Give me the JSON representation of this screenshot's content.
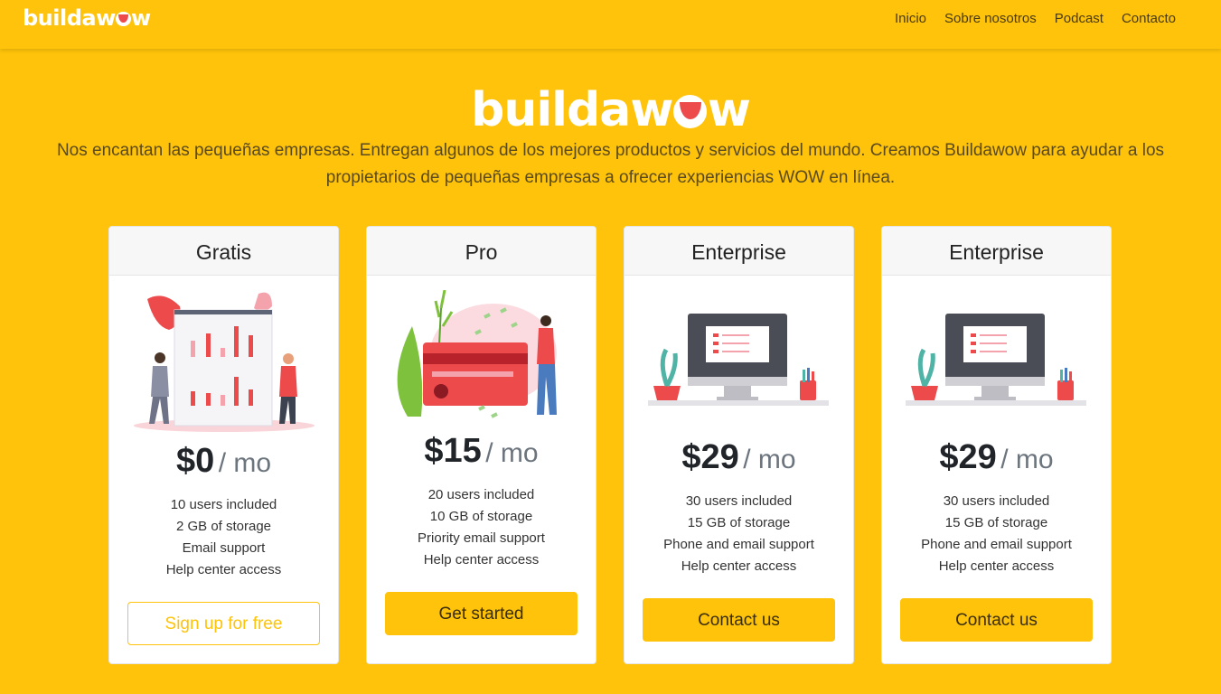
{
  "nav": {
    "brand": "buildawow",
    "links": [
      "Inicio",
      "Sobre nosotros",
      "Podcast",
      "Contacto"
    ]
  },
  "hero": {
    "logo": "buildawow",
    "tagline": "Nos encantan las pequeñas empresas. Entregan algunos de los mejores productos y servicios del mundo. Creamos Buildawow para ayudar a los propietarios de pequeñas empresas a ofrecer experiencias WOW en línea."
  },
  "plans": [
    {
      "name": "Gratis",
      "illustration": "team-chart-illustration",
      "price": "$0",
      "period": "/ mo",
      "features": [
        "10 users included",
        "2 GB of storage",
        "Email support",
        "Help center access"
      ],
      "button": "Sign up for free",
      "button_style": "outline"
    },
    {
      "name": "Pro",
      "illustration": "credit-card-illustration",
      "price": "$15",
      "period": "/ mo",
      "features": [
        "20 users included",
        "10 GB of storage",
        "Priority email support",
        "Help center access"
      ],
      "button": "Get started",
      "button_style": "solid"
    },
    {
      "name": "Enterprise",
      "illustration": "desktop-monitor-illustration",
      "price": "$29",
      "period": "/ mo",
      "features": [
        "30 users included",
        "15 GB of storage",
        "Phone and email support",
        "Help center access"
      ],
      "button": "Contact us",
      "button_style": "solid"
    },
    {
      "name": "Enterprise",
      "illustration": "desktop-monitor-illustration",
      "price": "$29",
      "period": "/ mo",
      "features": [
        "30 users included",
        "15 GB of storage",
        "Phone and email support",
        "Help center access"
      ],
      "button": "Contact us",
      "button_style": "solid"
    }
  ],
  "colors": {
    "brand_yellow": "#FEC30A",
    "accent_red": "#ED4A4C",
    "text_dark": "#212529",
    "text_muted": "#6c757d"
  }
}
